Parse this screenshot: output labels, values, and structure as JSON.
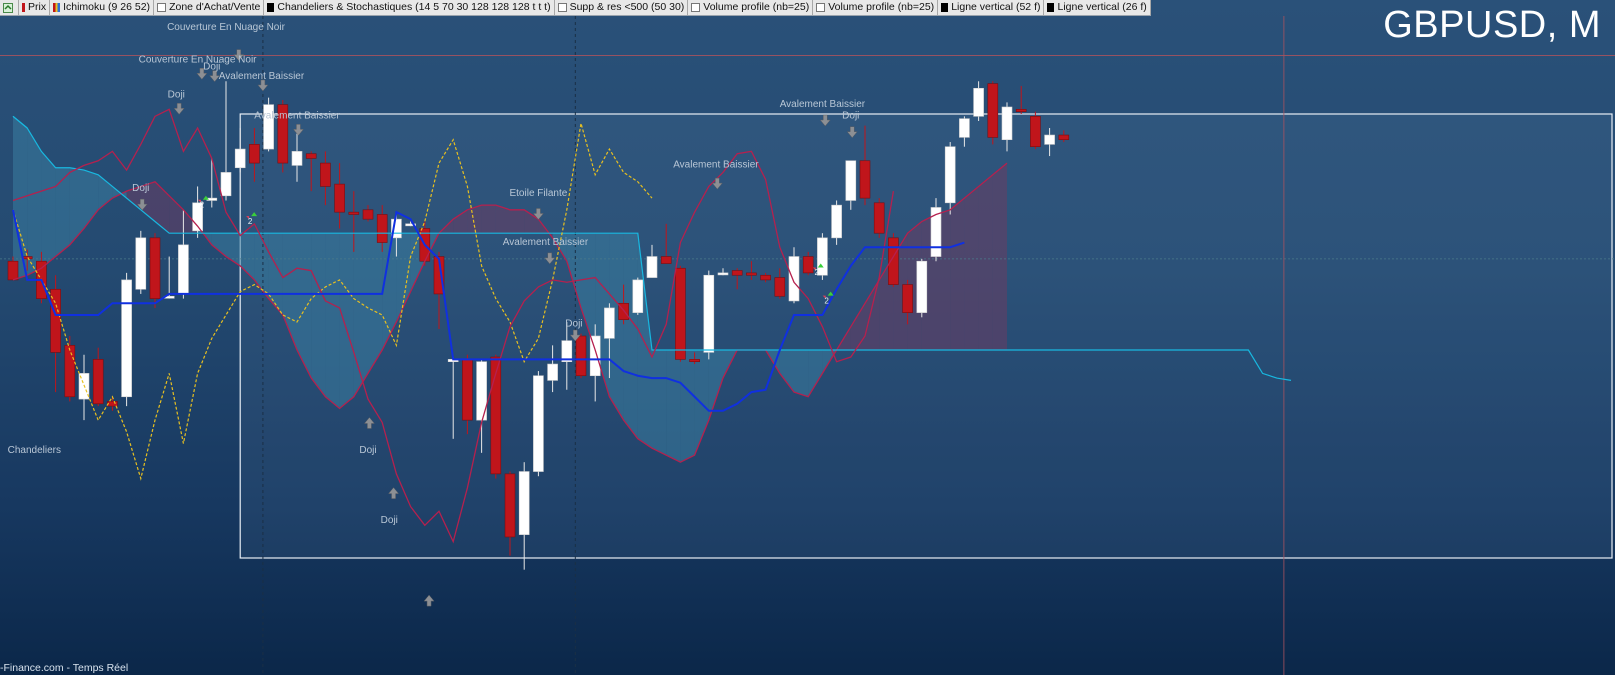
{
  "toolbar": {
    "items": [
      {
        "label": "Prix",
        "swatch": "#c0151b",
        "kind": "swatch"
      },
      {
        "label": "Ichimoku (9 26 52)",
        "swatch": "#2f6fd6",
        "kind": "multi"
      },
      {
        "label": "Zone d'Achat/Vente",
        "kind": "box"
      },
      {
        "label": "Chandeliers & Stochastiques (14 5 70 30 128 128 128 t t t)",
        "swatch": "#000000",
        "kind": "swatch"
      },
      {
        "label": "Supp & res <500 (50 30)",
        "kind": "box"
      },
      {
        "label": "Volume profile (nb=25)",
        "kind": "box"
      },
      {
        "label": "Volume profile (nb=25)",
        "kind": "box"
      },
      {
        "label": "Ligne vertical (52 f)",
        "swatch": "#000000",
        "kind": "swatch"
      },
      {
        "label": "Ligne vertical (26 f)",
        "swatch": "#000000",
        "kind": "swatch"
      }
    ]
  },
  "symbol": "GBPUSD, M",
  "footer": "-Finance.com - Temps Réel",
  "colors": {
    "bull": "#ffffff",
    "bear": "#c0151b",
    "kijun": "#1030e0",
    "tenkan": "#b5204e",
    "senkou_a": "#18b8e0",
    "chikou": "#e8c020",
    "cloud_bull": "#3a7ea0",
    "cloud_bear": "#6a3d62"
  },
  "chart_data": {
    "type": "candlestick",
    "candles": [
      {
        "o": 1.538,
        "h": 1.54,
        "l": 1.53,
        "c": 1.53
      },
      {
        "o": 1.54,
        "h": 1.543,
        "l": 1.534,
        "c": 1.539
      },
      {
        "o": 1.538,
        "h": 1.542,
        "l": 1.52,
        "c": 1.522
      },
      {
        "o": 1.526,
        "h": 1.532,
        "l": 1.482,
        "c": 1.499
      },
      {
        "o": 1.502,
        "h": 1.506,
        "l": 1.478,
        "c": 1.48
      },
      {
        "o": 1.479,
        "h": 1.498,
        "l": 1.47,
        "c": 1.49
      },
      {
        "o": 1.496,
        "h": 1.501,
        "l": 1.476,
        "c": 1.477
      },
      {
        "o": 1.478,
        "h": 1.48,
        "l": 1.474,
        "c": 1.476
      },
      {
        "o": 1.48,
        "h": 1.533,
        "l": 1.476,
        "c": 1.53
      },
      {
        "o": 1.526,
        "h": 1.551,
        "l": 1.524,
        "c": 1.548
      },
      {
        "o": 1.548,
        "h": 1.55,
        "l": 1.518,
        "c": 1.522
      },
      {
        "o": 1.523,
        "h": 1.54,
        "l": 1.522,
        "c": 1.523
      },
      {
        "o": 1.524,
        "h": 1.56,
        "l": 1.522,
        "c": 1.545
      },
      {
        "o": 1.551,
        "h": 1.57,
        "l": 1.548,
        "c": 1.563
      },
      {
        "o": 1.564,
        "h": 1.582,
        "l": 1.561,
        "c": 1.565
      },
      {
        "o": 1.566,
        "h": 1.615,
        "l": 1.564,
        "c": 1.576
      },
      {
        "o": 1.578,
        "h": 1.595,
        "l": 1.576,
        "c": 1.586
      },
      {
        "o": 1.588,
        "h": 1.595,
        "l": 1.572,
        "c": 1.58
      },
      {
        "o": 1.586,
        "h": 1.608,
        "l": 1.585,
        "c": 1.605
      },
      {
        "o": 1.605,
        "h": 1.607,
        "l": 1.576,
        "c": 1.58
      },
      {
        "o": 1.579,
        "h": 1.595,
        "l": 1.572,
        "c": 1.585
      },
      {
        "o": 1.584,
        "h": 1.585,
        "l": 1.568,
        "c": 1.582
      },
      {
        "o": 1.58,
        "h": 1.585,
        "l": 1.562,
        "c": 1.57
      },
      {
        "o": 1.571,
        "h": 1.58,
        "l": 1.552,
        "c": 1.559
      },
      {
        "o": 1.559,
        "h": 1.568,
        "l": 1.542,
        "c": 1.558
      },
      {
        "o": 1.56,
        "h": 1.562,
        "l": 1.555,
        "c": 1.556
      },
      {
        "o": 1.558,
        "h": 1.562,
        "l": 1.542,
        "c": 1.546
      },
      {
        "o": 1.548,
        "h": 1.559,
        "l": 1.54,
        "c": 1.556
      },
      {
        "o": 1.554,
        "h": 1.555,
        "l": 1.553,
        "c": 1.554
      },
      {
        "o": 1.552,
        "h": 1.555,
        "l": 1.536,
        "c": 1.538
      },
      {
        "o": 1.54,
        "h": 1.542,
        "l": 1.509,
        "c": 1.524
      },
      {
        "o": 1.495,
        "h": 1.497,
        "l": 1.462,
        "c": 1.496
      },
      {
        "o": 1.496,
        "h": 1.498,
        "l": 1.464,
        "c": 1.47
      },
      {
        "o": 1.47,
        "h": 1.496,
        "l": 1.456,
        "c": 1.495
      },
      {
        "o": 1.497,
        "h": 1.498,
        "l": 1.445,
        "c": 1.447
      },
      {
        "o": 1.447,
        "h": 1.448,
        "l": 1.412,
        "c": 1.42
      },
      {
        "o": 1.421,
        "h": 1.452,
        "l": 1.406,
        "c": 1.448
      },
      {
        "o": 1.448,
        "h": 1.491,
        "l": 1.446,
        "c": 1.489
      },
      {
        "o": 1.487,
        "h": 1.502,
        "l": 1.482,
        "c": 1.494
      },
      {
        "o": 1.495,
        "h": 1.512,
        "l": 1.483,
        "c": 1.504
      },
      {
        "o": 1.506,
        "h": 1.507,
        "l": 1.488,
        "c": 1.489
      },
      {
        "o": 1.489,
        "h": 1.511,
        "l": 1.478,
        "c": 1.506
      },
      {
        "o": 1.505,
        "h": 1.52,
        "l": 1.488,
        "c": 1.518
      },
      {
        "o": 1.52,
        "h": 1.528,
        "l": 1.511,
        "c": 1.513
      },
      {
        "o": 1.516,
        "h": 1.531,
        "l": 1.515,
        "c": 1.53
      },
      {
        "o": 1.531,
        "h": 1.545,
        "l": 1.531,
        "c": 1.54
      },
      {
        "o": 1.54,
        "h": 1.554,
        "l": 1.538,
        "c": 1.537
      },
      {
        "o": 1.535,
        "h": 1.536,
        "l": 1.495,
        "c": 1.496
      },
      {
        "o": 1.496,
        "h": 1.499,
        "l": 1.494,
        "c": 1.495
      },
      {
        "o": 1.499,
        "h": 1.534,
        "l": 1.496,
        "c": 1.532
      },
      {
        "o": 1.533,
        "h": 1.535,
        "l": 1.532,
        "c": 1.533
      },
      {
        "o": 1.534,
        "h": 1.535,
        "l": 1.526,
        "c": 1.532
      },
      {
        "o": 1.533,
        "h": 1.538,
        "l": 1.53,
        "c": 1.532
      },
      {
        "o": 1.532,
        "h": 1.533,
        "l": 1.529,
        "c": 1.53
      },
      {
        "o": 1.531,
        "h": 1.535,
        "l": 1.522,
        "c": 1.523
      },
      {
        "o": 1.521,
        "h": 1.544,
        "l": 1.52,
        "c": 1.54
      },
      {
        "o": 1.54,
        "h": 1.542,
        "l": 1.532,
        "c": 1.533
      },
      {
        "o": 1.532,
        "h": 1.55,
        "l": 1.53,
        "c": 1.548
      },
      {
        "o": 1.548,
        "h": 1.564,
        "l": 1.545,
        "c": 1.562
      },
      {
        "o": 1.564,
        "h": 1.58,
        "l": 1.56,
        "c": 1.581
      },
      {
        "o": 1.581,
        "h": 1.596,
        "l": 1.562,
        "c": 1.565
      },
      {
        "o": 1.563,
        "h": 1.565,
        "l": 1.548,
        "c": 1.55
      },
      {
        "o": 1.548,
        "h": 1.55,
        "l": 1.527,
        "c": 1.528
      },
      {
        "o": 1.528,
        "h": 1.53,
        "l": 1.511,
        "c": 1.516
      },
      {
        "o": 1.516,
        "h": 1.539,
        "l": 1.514,
        "c": 1.538
      },
      {
        "o": 1.54,
        "h": 1.565,
        "l": 1.538,
        "c": 1.561
      },
      {
        "o": 1.563,
        "h": 1.589,
        "l": 1.558,
        "c": 1.587
      },
      {
        "o": 1.591,
        "h": 1.6,
        "l": 1.587,
        "c": 1.599
      },
      {
        "o": 1.6,
        "h": 1.615,
        "l": 1.598,
        "c": 1.612
      },
      {
        "o": 1.614,
        "h": 1.615,
        "l": 1.588,
        "c": 1.591
      },
      {
        "o": 1.59,
        "h": 1.606,
        "l": 1.585,
        "c": 1.604
      },
      {
        "o": 1.603,
        "h": 1.613,
        "l": 1.601,
        "c": 1.602
      },
      {
        "o": 1.6,
        "h": 1.602,
        "l": 1.586,
        "c": 1.587
      },
      {
        "o": 1.588,
        "h": 1.595,
        "l": 1.583,
        "c": 1.592
      },
      {
        "o": 1.592,
        "h": 1.594,
        "l": 1.589,
        "c": 1.59
      }
    ],
    "ichimoku": {
      "tenkan": [
        1.564,
        1.566,
        1.568,
        1.57,
        1.576,
        1.579,
        1.581,
        1.585,
        1.577,
        1.588,
        1.6,
        1.603,
        1.585,
        1.595,
        1.582,
        1.559,
        1.549,
        1.554,
        1.542,
        1.531,
        1.535,
        1.534,
        1.521,
        1.518,
        1.499,
        1.479,
        1.469,
        1.447,
        1.433,
        1.425,
        1.431,
        1.418,
        1.441,
        1.469,
        1.49,
        1.51,
        1.521,
        1.527,
        1.53,
        1.529,
        1.53,
        1.531,
        1.524,
        1.517,
        1.509,
        1.497,
        1.511,
        1.546,
        1.559,
        1.57,
        1.576,
        1.584,
        1.585,
        1.573,
        1.544,
        1.529,
        1.522,
        1.51,
        1.495,
        1.497,
        1.506,
        1.531,
        1.568
      ],
      "kijun": [
        1.56,
        1.53,
        1.53,
        1.515,
        1.515,
        1.515,
        1.515,
        1.52,
        1.52,
        1.52,
        1.52,
        1.524,
        1.524,
        1.524,
        1.524,
        1.524,
        1.524,
        1.524,
        1.524,
        1.524,
        1.524,
        1.524,
        1.524,
        1.524,
        1.524,
        1.524,
        1.524,
        1.559,
        1.556,
        1.545,
        1.539,
        1.496,
        1.496,
        1.496,
        1.496,
        1.496,
        1.496,
        1.496,
        1.496,
        1.496,
        1.496,
        1.496,
        1.496,
        1.491,
        1.489,
        1.488,
        1.488,
        1.486,
        1.48,
        1.474,
        1.474,
        1.477,
        1.482,
        1.483,
        1.5,
        1.515,
        1.515,
        1.515,
        1.526,
        1.536,
        1.544,
        1.544,
        1.544,
        1.544,
        1.544,
        1.544,
        1.544,
        1.546
      ],
      "senkou_a": [
        1.6,
        1.595,
        1.585,
        1.578,
        1.578,
        1.577,
        1.575,
        1.57,
        1.565,
        1.56,
        1.555,
        1.55,
        1.55,
        1.55,
        1.55,
        1.55,
        1.55,
        1.55,
        1.55,
        1.55,
        1.55,
        1.55,
        1.55,
        1.55,
        1.55,
        1.55,
        1.55,
        1.55,
        1.55,
        1.55,
        1.55,
        1.55,
        1.55,
        1.55,
        1.55,
        1.55,
        1.55,
        1.55,
        1.55,
        1.55,
        1.55,
        1.55,
        1.55,
        1.55,
        1.55,
        1.5,
        1.5,
        1.5,
        1.5,
        1.5,
        1.5,
        1.5,
        1.5,
        1.5,
        1.5,
        1.5,
        1.5,
        1.5,
        1.5,
        1.5,
        1.5,
        1.5,
        1.5,
        1.5,
        1.5,
        1.5,
        1.5,
        1.5,
        1.5,
        1.5,
        1.5,
        1.5,
        1.5,
        1.5,
        1.5,
        1.5,
        1.5,
        1.5,
        1.5,
        1.5,
        1.5,
        1.5,
        1.5,
        1.5,
        1.5,
        1.5,
        1.5,
        1.5,
        1.49,
        1.488,
        1.487
      ],
      "senkou_b": [
        1.53,
        1.532,
        1.535,
        1.54,
        1.545,
        1.552,
        1.56,
        1.565,
        1.568,
        1.57,
        1.572,
        1.566,
        1.56,
        1.553,
        1.545,
        1.54,
        1.536,
        1.53,
        1.522,
        1.515,
        1.5,
        1.488,
        1.48,
        1.475,
        1.48,
        1.49,
        1.5,
        1.512,
        1.525,
        1.538,
        1.55,
        1.556,
        1.56,
        1.562,
        1.562,
        1.56,
        1.56,
        1.556,
        1.548,
        1.538,
        1.518,
        1.5,
        1.48,
        1.47,
        1.462,
        1.458,
        1.455,
        1.452,
        1.455,
        1.47,
        1.488,
        1.5,
        1.5,
        1.5,
        1.49,
        1.482,
        1.48,
        1.49,
        1.5,
        1.51,
        1.52,
        1.53,
        1.54,
        1.55,
        1.555,
        1.558,
        1.56,
        1.565,
        1.57,
        1.575,
        1.58
      ],
      "chikou": [
        1.56,
        1.54,
        1.53,
        1.52,
        1.5,
        1.485,
        1.47,
        1.48,
        1.465,
        1.445,
        1.47,
        1.49,
        1.46,
        1.49,
        1.505,
        1.515,
        1.525,
        1.528,
        1.524,
        1.515,
        1.512,
        1.522,
        1.527,
        1.53,
        1.522,
        1.518,
        1.515,
        1.502,
        1.54,
        1.555,
        1.58,
        1.59,
        1.57,
        1.536,
        1.522,
        1.512,
        1.495,
        1.505,
        1.53,
        1.56,
        1.597,
        1.575,
        1.586,
        1.576,
        1.572,
        1.565
      ]
    },
    "annotations": [
      {
        "text": "Couverture En Nuage Noir",
        "i": 15.0,
        "p": 1.637
      },
      {
        "text": "Couverture En Nuage Noir",
        "i": 13.0,
        "p": 1.623
      },
      {
        "text": "Doji",
        "i": 14.0,
        "p": 1.62
      },
      {
        "text": "Avalement Baissier",
        "i": 17.5,
        "p": 1.616
      },
      {
        "text": "Doji",
        "i": 11.5,
        "p": 1.608
      },
      {
        "text": "Avalement Baissier",
        "i": 20.0,
        "p": 1.599
      },
      {
        "text": "Doji",
        "i": 9.0,
        "p": 1.568
      },
      {
        "text": "Etoile Filante",
        "i": 37.0,
        "p": 1.566
      },
      {
        "text": "Avalement Baissier",
        "i": 37.5,
        "p": 1.545
      },
      {
        "text": "Doji",
        "i": 39.5,
        "p": 1.51
      },
      {
        "text": "Avalement Baissier",
        "i": 49.5,
        "p": 1.578
      },
      {
        "text": "Avalement Baissier",
        "i": 57.0,
        "p": 1.604
      },
      {
        "text": "Doji",
        "i": 59.0,
        "p": 1.599
      },
      {
        "text": "Chandeliers",
        "i": 1.5,
        "p": 1.456
      },
      {
        "text": "Doji",
        "i": 25.0,
        "p": 1.456
      },
      {
        "text": "Doji",
        "i": 26.5,
        "p": 1.426
      },
      {
        "text": "2",
        "i": 13.3,
        "p": 1.561
      },
      {
        "text": "2",
        "i": 16.7,
        "p": 1.554
      },
      {
        "text": "2",
        "i": 56.6,
        "p": 1.532
      },
      {
        "text": "2",
        "i": 57.3,
        "p": 1.52
      }
    ],
    "arrows": [
      {
        "i": 15.9,
        "p": 1.626,
        "dir": "down"
      },
      {
        "i": 13.3,
        "p": 1.618,
        "dir": "down"
      },
      {
        "i": 14.2,
        "p": 1.617,
        "dir": "down"
      },
      {
        "i": 17.6,
        "p": 1.613,
        "dir": "down"
      },
      {
        "i": 11.7,
        "p": 1.603,
        "dir": "down"
      },
      {
        "i": 20.1,
        "p": 1.594,
        "dir": "down"
      },
      {
        "i": 9.1,
        "p": 1.562,
        "dir": "down"
      },
      {
        "i": 37.0,
        "p": 1.558,
        "dir": "down"
      },
      {
        "i": 37.8,
        "p": 1.539,
        "dir": "down"
      },
      {
        "i": 39.6,
        "p": 1.506,
        "dir": "down"
      },
      {
        "i": 49.6,
        "p": 1.571,
        "dir": "down"
      },
      {
        "i": 57.2,
        "p": 1.598,
        "dir": "down"
      },
      {
        "i": 59.1,
        "p": 1.593,
        "dir": "down"
      },
      {
        "i": 25.1,
        "p": 1.469,
        "dir": "up"
      },
      {
        "i": 26.8,
        "p": 1.439,
        "dir": "up"
      },
      {
        "i": 29.3,
        "p": 1.393,
        "dir": "up"
      }
    ],
    "signals": [
      {
        "i": 13.3,
        "p": 1.566
      },
      {
        "i": 16.7,
        "p": 1.559
      },
      {
        "i": 56.6,
        "p": 1.537
      },
      {
        "i": 57.3,
        "p": 1.525
      }
    ],
    "zone": {
      "i_from": 16.0,
      "p_top": 1.601,
      "p_bottom": 1.411
    },
    "hlines": [
      1.626,
      1.539
    ],
    "vlines": [
      17.6,
      39.6
    ],
    "cursor_line_index": 89.5,
    "grid": false
  }
}
